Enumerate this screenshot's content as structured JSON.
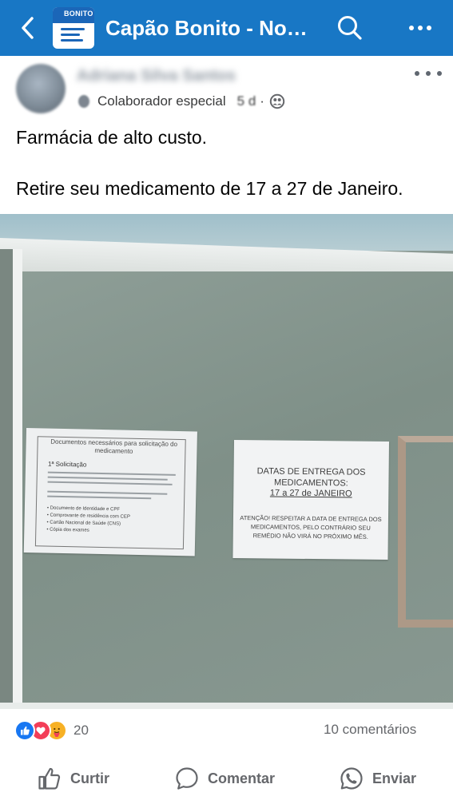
{
  "topbar": {
    "title": "Capão Bonito - Notícias",
    "thumb_word": "BONITO",
    "bg_color": "#1877c5"
  },
  "post": {
    "author": "Adriana Silva Santos",
    "role": "Colaborador especial",
    "time": "5 d",
    "dot": "·",
    "text_line1": "Farmácia de alto custo.",
    "text_line2": "Retire seu medicamento de 17 a 27 de Janeiro."
  },
  "photo": {
    "left_sheet": {
      "title": "Documentos necessários para solicitação do medicamento",
      "section1": "1ª Solicitação",
      "items": [
        "• Documento de Identidade e CPF",
        "• Comprovante de residência com CEP",
        "• Cartão Nacional de Saúde (CNS)",
        "• Cópia dos exames"
      ]
    },
    "right_sheet": {
      "heading": "DATAS DE ENTREGA DOS MEDICAMENTOS:",
      "date": "17 a 27 de JANEIRO",
      "warning": "ATENÇÃO! RESPEITAR A DATA DE ENTREGA DOS MEDICAMENTOS, PELO CONTRÁRIO SEU REMÉDIO NÃO VIRÁ NO PRÓXIMO MÊS."
    }
  },
  "stats": {
    "reactions_count": "20",
    "comments": "10 comentários"
  },
  "actions": {
    "like": "Curtir",
    "comment": "Comentar",
    "share": "Enviar"
  }
}
